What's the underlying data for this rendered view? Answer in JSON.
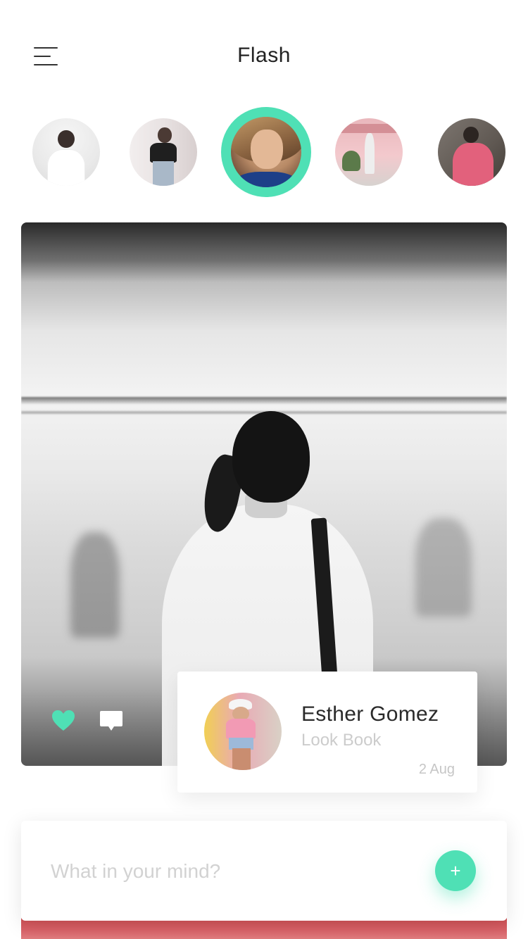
{
  "header": {
    "title": "Flash"
  },
  "stories": [
    {
      "name": "story-1"
    },
    {
      "name": "story-2"
    },
    {
      "name": "story-3",
      "active": true
    },
    {
      "name": "story-4"
    },
    {
      "name": "story-5"
    }
  ],
  "post": {
    "author": {
      "name": "Esther Gomez",
      "subtitle": "Look Book",
      "date": "2 Aug"
    },
    "actions": {
      "like_icon": "heart-icon",
      "comment_icon": "comment-icon"
    }
  },
  "composer": {
    "placeholder": "What in your mind?",
    "add_label": "+"
  },
  "colors": {
    "accent": "#4fe0b5",
    "text_primary": "#222222",
    "text_muted": "#cccccc"
  }
}
